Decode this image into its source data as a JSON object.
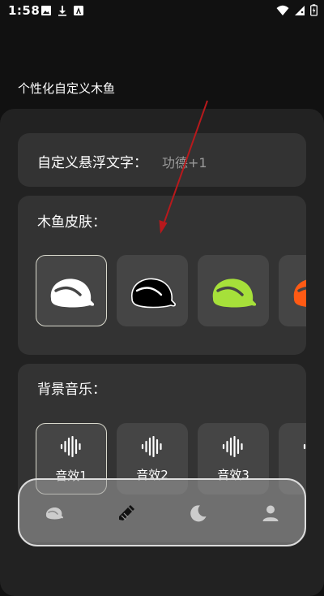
{
  "status_bar": {
    "time": "1:58",
    "left_icons": [
      "image-icon",
      "download-icon",
      "a-icon"
    ],
    "right_icons": [
      "wifi-icon",
      "signal-icon",
      "battery-icon"
    ]
  },
  "page": {
    "title": "个性化自定义木鱼"
  },
  "custom_text": {
    "label": "自定义悬浮文字：",
    "value": "功德+1"
  },
  "skin": {
    "label": "木鱼皮肤：",
    "options": [
      {
        "icon": "wooden-fish-white-icon",
        "color": "#ffffff",
        "selected": true
      },
      {
        "icon": "wooden-fish-black-icon",
        "color": "#000000",
        "selected": false
      },
      {
        "icon": "wooden-fish-green-icon",
        "color": "#a6e03a",
        "selected": false
      },
      {
        "icon": "wooden-fish-orange-icon",
        "color": "#ff5a14",
        "selected": false
      }
    ]
  },
  "music": {
    "label": "背景音乐：",
    "options": [
      {
        "label": "音效1",
        "icon": "sound-wave-icon",
        "selected": true
      },
      {
        "label": "音效2",
        "icon": "sound-wave-icon",
        "selected": false
      },
      {
        "label": "音效3",
        "icon": "sound-wave-icon",
        "selected": false
      },
      {
        "label": "音",
        "icon": "sound-wave-icon",
        "selected": false
      }
    ]
  },
  "bottom_nav": {
    "items": [
      {
        "icon": "wooden-fish-icon",
        "active": false
      },
      {
        "icon": "paintbrush-icon",
        "active": true
      },
      {
        "icon": "moon-icon",
        "active": false
      },
      {
        "icon": "user-icon",
        "active": false
      }
    ]
  },
  "colors": {
    "background": "#111111",
    "panel": "#222222",
    "card": "#333333",
    "tile": "#454545",
    "selected_border": "#d8d8cc",
    "hint_text": "#9a9a9a",
    "annotation_arrow": "#b8191c"
  }
}
